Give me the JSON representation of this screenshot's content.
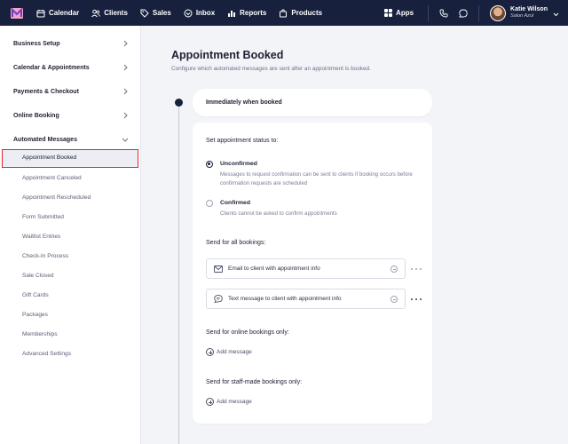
{
  "nav": {
    "items": [
      {
        "label": "Calendar",
        "icon": "calendar-icon"
      },
      {
        "label": "Clients",
        "icon": "clients-icon"
      },
      {
        "label": "Sales",
        "icon": "tag-icon"
      },
      {
        "label": "Inbox",
        "icon": "inbox-icon"
      },
      {
        "label": "Reports",
        "icon": "bar-chart-icon"
      },
      {
        "label": "Products",
        "icon": "bag-icon"
      }
    ],
    "apps_label": "Apps",
    "user": {
      "name": "Katie Wilson",
      "subtitle": "Salon Azul"
    }
  },
  "sidebar": {
    "sections": [
      {
        "label": "Business Setup",
        "chevron": "chevron-right-icon"
      },
      {
        "label": "Calendar & Appointments",
        "chevron": "chevron-right-icon"
      },
      {
        "label": "Payments & Checkout",
        "chevron": "chevron-right-icon"
      },
      {
        "label": "Online Booking",
        "chevron": "chevron-right-icon"
      },
      {
        "label": "Automated Messages",
        "chevron": "chevron-down-icon"
      }
    ],
    "sub_items": [
      "Appointment Booked",
      "Appointment Canceled",
      "Appointment Rescheduled",
      "Form Submitted",
      "Waitlist Entries",
      "Check-In Process",
      "Sale Closed",
      "Gift Cards",
      "Packages",
      "Memberships",
      "Advanced Settings"
    ],
    "active_sub_item": "Appointment Booked"
  },
  "main": {
    "title": "Appointment Booked",
    "description": "Configure which automated messages are sent after an appointment is booked.",
    "trigger_label": "Immediately when booked",
    "status_heading": "Set appointment status to:",
    "options": [
      {
        "title": "Unconfirmed",
        "description": "Messages to request confirmation can be sent to clients if booking occurs before confirmation requests are scheduled",
        "selected": true
      },
      {
        "title": "Confirmed",
        "description": "Clients cannot be asked to confirm appointments",
        "selected": false
      }
    ],
    "all_bookings_heading": "Send for all bookings:",
    "messages": [
      {
        "label": "Email to client with appointment info",
        "icon": "envelope-icon"
      },
      {
        "label": "Text message to client with appointment info",
        "icon": "chat-bubble-icon"
      }
    ],
    "online_heading": "Send for online bookings only:",
    "staff_heading": "Send for staff-made bookings only:",
    "add_message_label": "Add message"
  },
  "colors": {
    "nav_bg": "#17203d",
    "page_bg": "#f3f4f8",
    "highlight_border": "#e3262c"
  }
}
